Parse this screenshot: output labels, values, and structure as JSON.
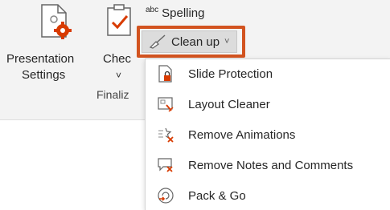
{
  "ribbon": {
    "presentation_settings": {
      "line1": "Presentation",
      "line2": "Settings"
    },
    "check": {
      "label": "Chec",
      "chevron": "˅"
    },
    "group_label": "Finaliz",
    "spelling": {
      "abc": "abc",
      "label": "Spelling"
    },
    "cleanup": {
      "label": "Clean up",
      "chevron": "˅"
    }
  },
  "menu": {
    "items": [
      {
        "label": "Slide Protection",
        "icon": "slide-protection-icon"
      },
      {
        "label": "Layout Cleaner",
        "icon": "layout-cleaner-icon"
      },
      {
        "label": "Remove Animations",
        "icon": "remove-animations-icon"
      },
      {
        "label": "Remove Notes and Comments",
        "icon": "remove-notes-icon"
      },
      {
        "label": "Pack & Go",
        "icon": "pack-and-go-icon"
      }
    ]
  },
  "colors": {
    "highlight": "#d2531f",
    "ribbon_bg": "#f3f3f3",
    "accent_red": "#d83b01"
  }
}
